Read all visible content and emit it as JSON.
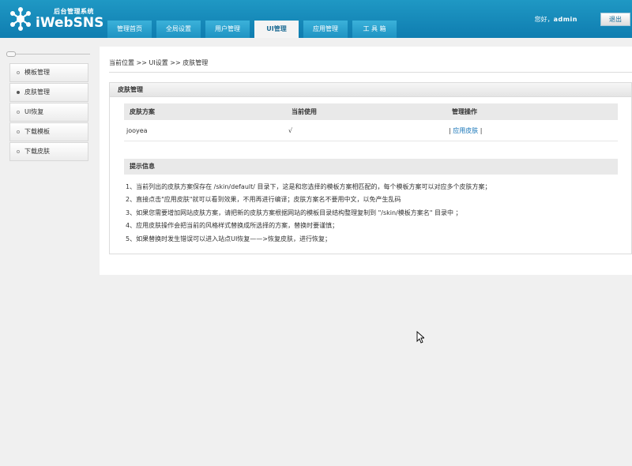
{
  "header": {
    "logo_subtitle": "后台管理系统",
    "logo_title": "iWebSNS",
    "greeting_prefix": "您好，",
    "username": "admin",
    "logout_label": "退出"
  },
  "nav": {
    "tabs": [
      {
        "label": "管理首页"
      },
      {
        "label": "全局设置"
      },
      {
        "label": "用户管理"
      },
      {
        "label": "UI管理"
      },
      {
        "label": "应用管理"
      },
      {
        "label": "工 具 箱"
      }
    ],
    "active": "UI管理"
  },
  "sidebar": {
    "items": [
      {
        "label": "模板管理"
      },
      {
        "label": "皮肤管理"
      },
      {
        "label": "UI恢复"
      },
      {
        "label": "下载模板"
      },
      {
        "label": "下载皮肤"
      }
    ],
    "active": "皮肤管理"
  },
  "breadcrumb": "当前位置 >> UI设置 >> 皮肤管理",
  "panel": {
    "title": "皮肤管理",
    "table": {
      "headers": [
        "皮肤方案",
        "当前使用",
        "管理操作"
      ],
      "rows": [
        {
          "name": "jooyea",
          "current": "√",
          "action_prefix": "| ",
          "action_link": "应用皮肤",
          "action_suffix": " |"
        }
      ]
    },
    "tips_title": "提示信息",
    "tips": [
      "1、当前列出的皮肤方案保存在 /skin/default/ 目录下，这是和您选择的模板方案相匹配的，每个模板方案可以对应多个皮肤方案；",
      "2、直接点击\"应用皮肤\"就可以看到效果，不用再进行编译；皮肤方案名不要用中文，以免产生乱码",
      "3、如果您需要增加网站皮肤方案，请把新的皮肤方案根据网站的模板目录结构整理复制到 \"/skin/模板方案名\" 目录中 ；",
      "4、应用皮肤操作会把当前的风格样式替换成所选择的方案，替换时要谨慎；",
      "5、如果替换时发生错误可以进入站点UI恢复——>恢复皮肤，进行恢复；"
    ]
  },
  "colors": {
    "header_blue": "#1589bb",
    "link_blue": "#1574b8"
  }
}
